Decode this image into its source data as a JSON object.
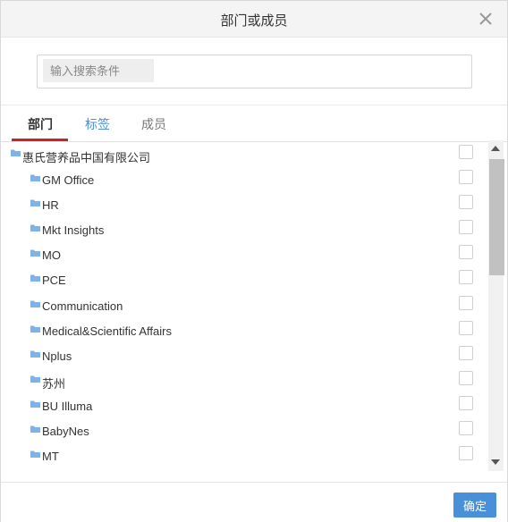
{
  "dialog": {
    "title": "部门或成员"
  },
  "search": {
    "placeholder": "输入搜索条件"
  },
  "tabs": [
    {
      "label": "部门",
      "active": true
    },
    {
      "label": "标签",
      "active": false
    },
    {
      "label": "成员",
      "active": false
    }
  ],
  "tree": {
    "root": "惠氏营养品中国有限公司",
    "children": [
      "GM Office",
      "HR",
      "Mkt Insights",
      "MO",
      "PCE",
      "Communication",
      "Medical&Scientific Affairs",
      "Nplus",
      "苏州",
      "BU Illuma",
      "BabyNes",
      "MT"
    ]
  },
  "footer": {
    "confirm_label": "确定"
  },
  "colors": {
    "accent": "#4a90d9",
    "tab_underline": "#c0262c",
    "folder": "#7fb2e5"
  },
  "icons": {
    "close": "close-icon",
    "folder": "folder-icon",
    "scroll_up": "triangle-up-icon",
    "scroll_down": "triangle-down-icon"
  }
}
